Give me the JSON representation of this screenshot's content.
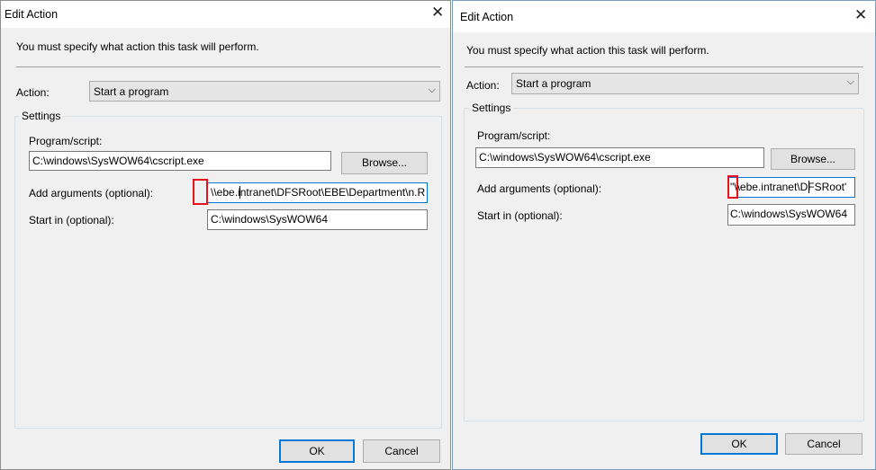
{
  "left_dialog": {
    "title": "Edit Action",
    "instruction": "You must specify what action this task will perform.",
    "action_label": "Action:",
    "action_value": "Start a program",
    "settings_label": "Settings",
    "program_label": "Program/script:",
    "program_value": "C:\\windows\\SysWOW64\\cscript.exe",
    "browse_label": "Browse...",
    "args_label": "Add arguments (optional):",
    "args_value": "\\\\ebe.intranet\\DFSRoot\\EBE\\Department\\n.R",
    "startin_label": "Start in (optional):",
    "startin_value": "C:\\windows\\SysWOW64",
    "ok_label": "OK",
    "cancel_label": "Cancel"
  },
  "right_dialog": {
    "title": "Edit Action",
    "instruction": "You must specify what action this task will perform.",
    "action_label": "Action:",
    "action_value": "Start a program",
    "settings_label": "Settings",
    "program_label": "Program/script:",
    "program_value": "C:\\windows\\SysWOW64\\cscript.exe",
    "browse_label": "Browse...",
    "args_label": "Add arguments (optional):",
    "args_value": "\"\\\\ebe.intranet\\DFSRoot'",
    "startin_label": "Start in (optional):",
    "startin_value": "C:\\windows\\SysWOW64",
    "ok_label": "OK",
    "cancel_label": "Cancel"
  },
  "icons": {
    "close": "close-icon",
    "dropdown": "chevron-down-icon"
  },
  "colors": {
    "dialog_bg": "#f0f0f0",
    "focus_accent": "#0078d7",
    "highlight_red": "#e8121f"
  }
}
